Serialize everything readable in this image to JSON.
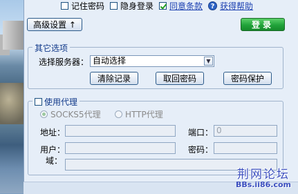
{
  "options": {
    "remember_password": "记住密码",
    "stealth_login": "隐身登录",
    "agree_terms": "同意条款",
    "get_help": "获得帮助"
  },
  "buttons": {
    "advanced": "高级设置 ↑",
    "login": "登录"
  },
  "other_options": {
    "legend": "其它选项",
    "server_label": "选择服务器：",
    "server_value": "自动选择",
    "clear_records": "清除记录",
    "retrieve_password": "取回密码",
    "password_protect": "密码保护"
  },
  "proxy": {
    "legend": "使用代理",
    "socks5": "SOCKS5代理",
    "http": "HTTP代理",
    "address_label": "地址：",
    "port_label": "端口：",
    "port_value": "0",
    "user_label": "用户：",
    "password_label": "密码：",
    "domain_label": "域："
  },
  "watermark": {
    "title": "荆网论坛",
    "url": "BBs.ii86.com"
  }
}
